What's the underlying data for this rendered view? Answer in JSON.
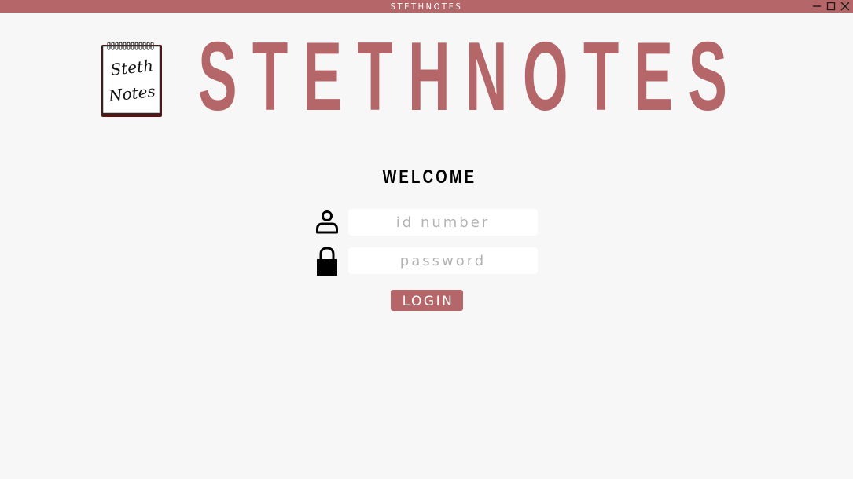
{
  "window": {
    "title": "STETHNOTES",
    "controls": [
      "minimize-icon",
      "maximize-icon",
      "close-icon"
    ]
  },
  "logo": {
    "text_line1": "Steth",
    "text_line2": "Notes",
    "icon": "spiral-notepad-logo"
  },
  "brand": {
    "title": "STETHNOTES"
  },
  "login_form": {
    "heading": "WELCOME",
    "id_field": {
      "icon": "user-icon",
      "value": "",
      "placeholder": "id number"
    },
    "password_field": {
      "icon": "lock-icon",
      "value": "",
      "placeholder": "password"
    },
    "login_label": "LOGIN"
  },
  "colors": {
    "accent": "#b56668",
    "background": "#f8f7f8",
    "field_background": "#ffffff",
    "text": "#000000"
  }
}
